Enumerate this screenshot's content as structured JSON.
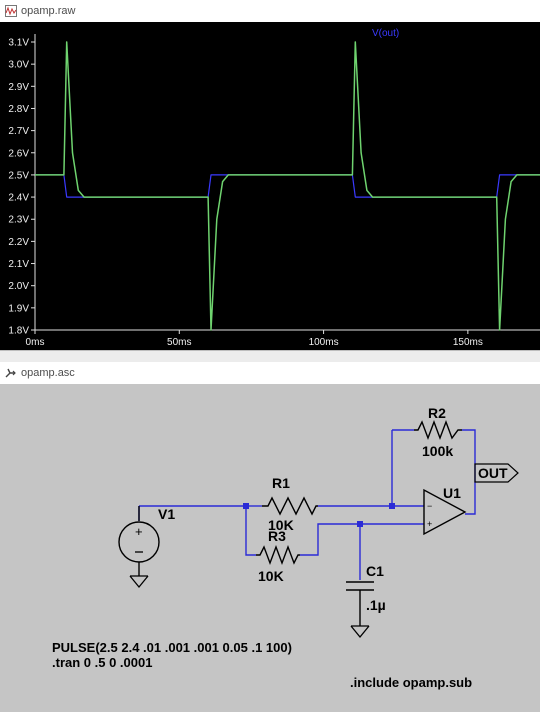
{
  "plot_window": {
    "title": "opamp.raw",
    "legend_label": "V(out)"
  },
  "schematic_window": {
    "title": "opamp.asc"
  },
  "chart_data": {
    "type": "line",
    "xlabel": "",
    "ylabel": "",
    "x_unit": "ms",
    "y_unit": "V",
    "xlim": [
      0,
      175
    ],
    "ylim": [
      1.8,
      3.1
    ],
    "x_ticks": [
      "0ms",
      "50ms",
      "100ms",
      "150ms"
    ],
    "y_ticks": [
      "3.1V",
      "3.0V",
      "2.9V",
      "2.8V",
      "2.7V",
      "2.6V",
      "2.5V",
      "2.4V",
      "2.3V",
      "2.2V",
      "2.1V",
      "2.0V",
      "1.9V",
      "1.8V"
    ],
    "grid": false,
    "series": [
      {
        "name": "V(out)",
        "color": "#6fd36f",
        "points": [
          [
            0,
            2.5
          ],
          [
            10,
            2.5
          ],
          [
            11,
            3.1
          ],
          [
            13,
            2.6
          ],
          [
            15,
            2.43
          ],
          [
            17,
            2.4
          ],
          [
            60,
            2.4
          ],
          [
            61,
            1.8
          ],
          [
            63,
            2.3
          ],
          [
            65,
            2.47
          ],
          [
            67,
            2.5
          ],
          [
            110,
            2.5
          ],
          [
            111,
            3.1
          ],
          [
            113,
            2.6
          ],
          [
            115,
            2.43
          ],
          [
            117,
            2.4
          ],
          [
            160,
            2.4
          ],
          [
            161,
            1.8
          ],
          [
            163,
            2.3
          ],
          [
            165,
            2.47
          ],
          [
            167,
            2.5
          ],
          [
            175,
            2.5
          ]
        ]
      },
      {
        "color": "#3a3aff",
        "points": [
          [
            0,
            2.5
          ],
          [
            10,
            2.5
          ],
          [
            11,
            2.4
          ],
          [
            60,
            2.4
          ],
          [
            61,
            2.5
          ],
          [
            110,
            2.5
          ],
          [
            111,
            2.4
          ],
          [
            160,
            2.4
          ],
          [
            161,
            2.5
          ],
          [
            175,
            2.5
          ]
        ]
      }
    ]
  },
  "schematic": {
    "components": {
      "v1": {
        "name": "V1"
      },
      "r1": {
        "name": "R1",
        "value": "10K"
      },
      "r2": {
        "name": "R2",
        "value": "100k"
      },
      "r3": {
        "name": "R3",
        "value": "10K"
      },
      "c1": {
        "name": "C1",
        "value": ".1µ"
      },
      "u1": {
        "name": "U1"
      }
    },
    "net_labels": {
      "out": "OUT"
    },
    "directives": {
      "pulse": "PULSE(2.5 2.4 .01 .001 .001 0.05 .1 100)",
      "tran": ".tran 0 .5 0 .0001",
      "include": ".include opamp.sub"
    },
    "colors": {
      "background": "#c5c5c5",
      "wire": "#2b2bd6",
      "component": "#000000"
    }
  }
}
